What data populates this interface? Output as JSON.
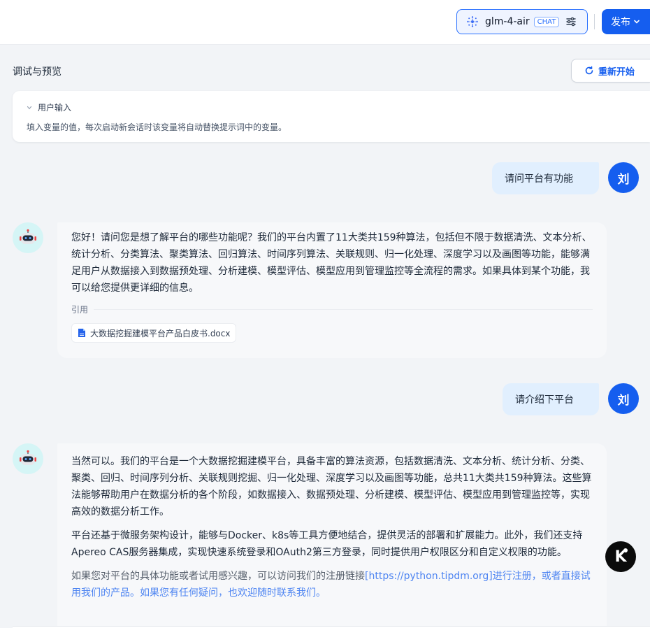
{
  "header": {
    "model_name": "glm-4-air",
    "model_badge": "CHAT",
    "publish_label": "发布"
  },
  "debug": {
    "title": "调试与预览",
    "restart_label": "重新开始"
  },
  "user_input": {
    "title": "用户输入",
    "description": "填入变量的值，每次启动新会话时该变量将自动替换提示词中的变量。"
  },
  "conversation": {
    "user_initial": "刘",
    "q1": "请问平台有功能",
    "a1": "您好！请问您是想了解平台的哪些功能呢？我们的平台内置了11大类共159种算法，包括但不限于数据清洗、文本分析、统计分析、分类算法、聚类算法、回归算法、时间序列算法、关联规则、归一化处理、深度学习以及画图等功能，能够满足用户从数据接入到数据预处理、分析建模、模型评估、模型应用到管理监控等全流程的需求。如果具体到某个功能，我可以给您提供更详细的信息。",
    "citation_label": "引用",
    "citation_file": "大数据挖掘建模平台产品白皮书.docx",
    "q2": "请介绍下平台",
    "a2_p1": "当然可以。我们的平台是一个大数据挖掘建模平台，具备丰富的算法资源，包括数据清洗、文本分析、统计分析、分类、聚类、回归、时间序列分析、关联规则挖掘、归一化处理、深度学习以及画图等功能，总共11大类共159种算法。这些算法能够帮助用户在数据分析的各个阶段，如数据接入、数据预处理、分析建模、模型评估、模型应用到管理监控等，实现高效的数据分析工作。",
    "a2_p2": "平台还基于微服务架构设计，能够与Docker、k8s等工具方便地结合，提供灵活的部署和扩展能力。此外，我们还支持Apereo CAS服务器集成，实现快速系统登录和OAuth2第三方登录，同时提供用户权限区分和自定义权限的功能。",
    "a2_p3_a": "如果您对平台的具体功能或者试用感兴趣，可以访问我们的注册链接",
    "a2_p3_link": "[https://python.tipdm.org]进行注册，或者直接试用我们的产品。如果您有任何疑问，也欢迎随时联系我们。"
  },
  "colors": {
    "accent": "#155eef",
    "user_bubble": "#e1effe",
    "bot_bubble": "#f7f8fa",
    "page_bg": "#f2f4f7"
  },
  "icons": [
    "model-spark-icon",
    "settings-sliders-icon",
    "chevron-down-icon",
    "refresh-icon",
    "robot-icon",
    "document-icon",
    "assistant-k-icon"
  ]
}
